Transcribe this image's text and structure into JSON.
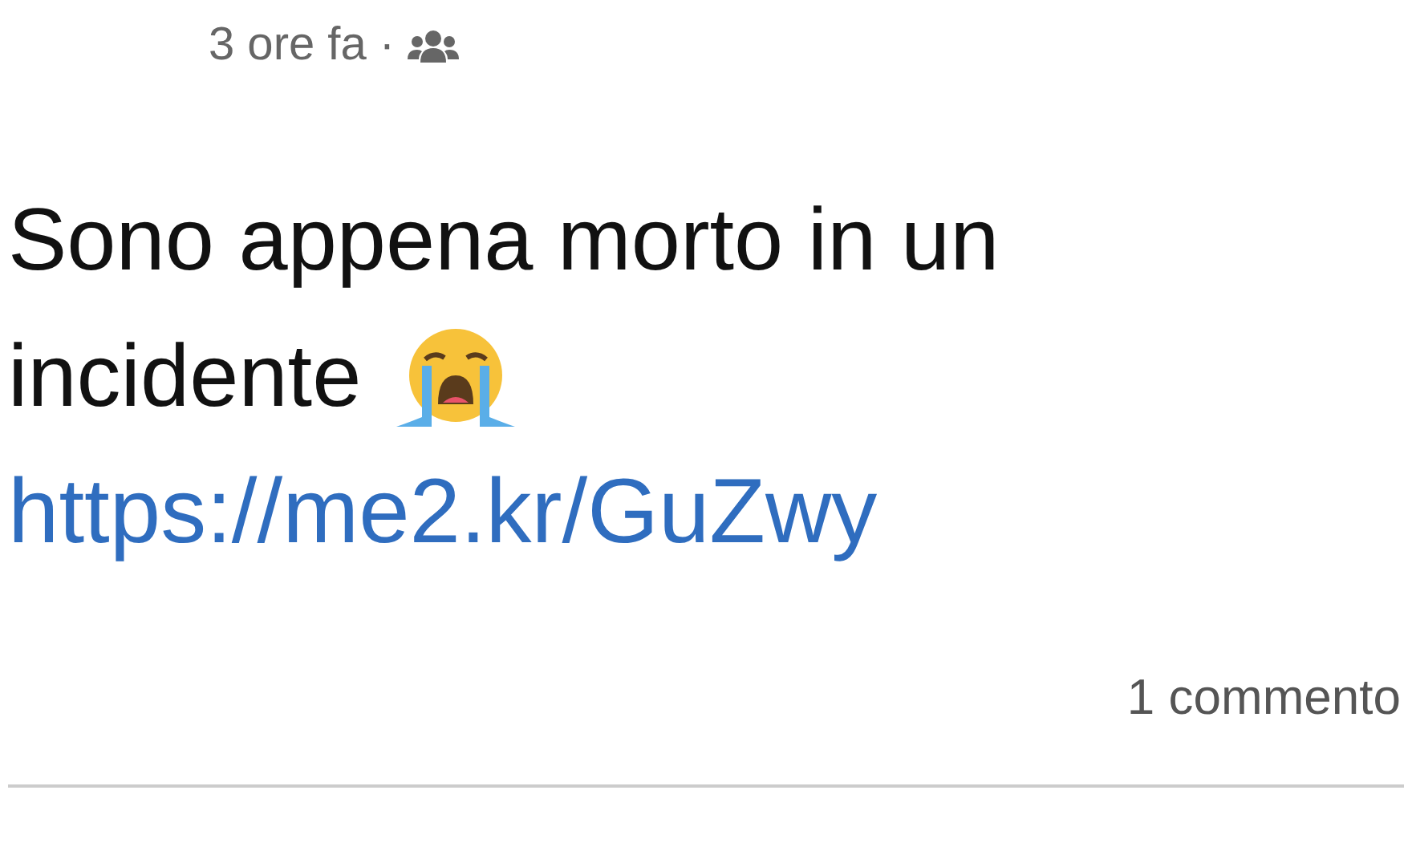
{
  "post": {
    "time": "3 ore fa",
    "separator": "·",
    "text_lines": [
      "Sono appena morto in un",
      "incidente"
    ],
    "link": "https://me2.kr/GuZwy",
    "comments": "1 commento"
  }
}
